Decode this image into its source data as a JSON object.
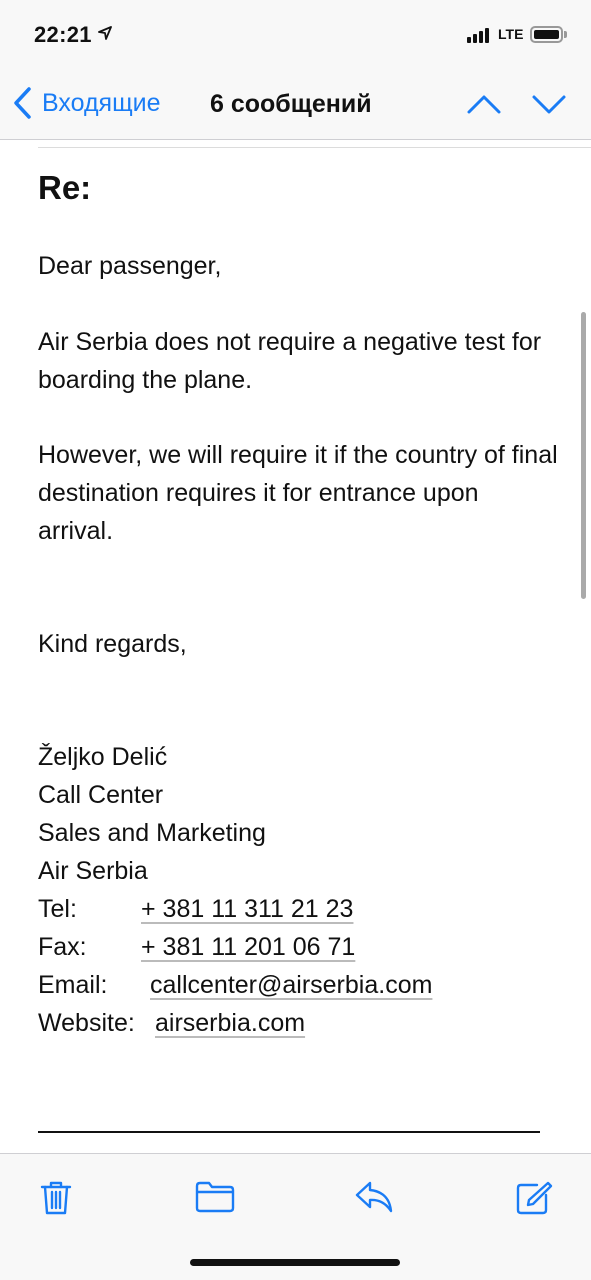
{
  "status_bar": {
    "time": "22:21",
    "network": "LTE",
    "icons": [
      "location-arrow-icon",
      "signal-icon",
      "battery-icon"
    ]
  },
  "nav": {
    "back_label": "Входящие",
    "title": "6 сообщений",
    "icons": [
      "chevron-left-icon",
      "chevron-up-icon",
      "chevron-down-icon"
    ]
  },
  "email": {
    "subject": "Re:",
    "greeting": "Dear passenger,",
    "paragraph_1": "Air Serbia does not require a negative test for boarding the plane.",
    "paragraph_2": "However, we will require it if the country of final destination requires it for entrance upon arrival.",
    "closing": "Kind regards,",
    "signature": {
      "name": "Željko Delić",
      "line_2": "Call Center",
      "line_3": "Sales and Marketing",
      "line_4": "Air Serbia",
      "tel_label": "Tel:",
      "tel_value": "+ 381 11 311 21 23",
      "fax_label": "Fax:",
      "fax_value": "+ 381 11 201 06 71",
      "email_label": "Email:",
      "email_value": "callcenter@airserbia.com",
      "website_label": "Website:",
      "website_value": "airserbia.com"
    }
  },
  "toolbar": {
    "icons": [
      "trash-icon",
      "folder-icon",
      "reply-icon",
      "compose-icon"
    ]
  },
  "colors": {
    "accent": "#1a7cf5",
    "bar_background": "#f8f8f8",
    "text": "#111111"
  }
}
